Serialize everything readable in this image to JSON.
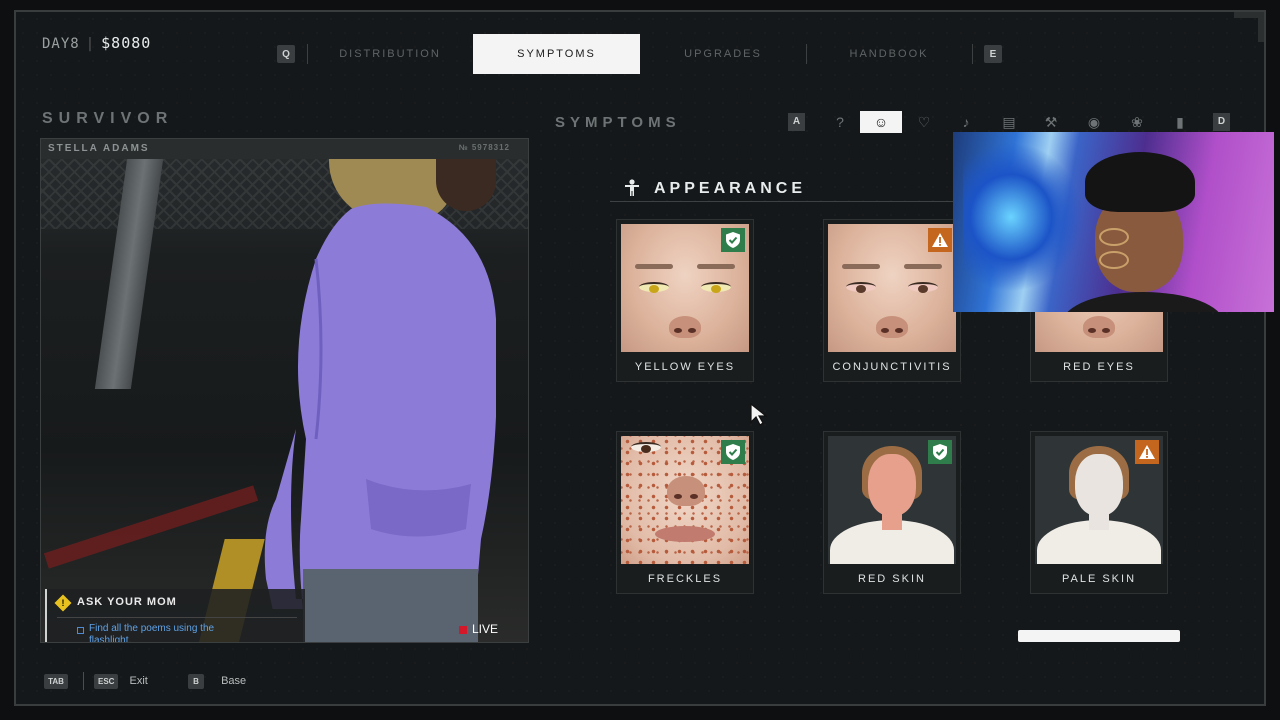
{
  "hud": {
    "day": "DAY8",
    "money": "$8080"
  },
  "nav": {
    "key_left": "Q",
    "key_right": "E",
    "tabs": [
      {
        "label": "DISTRIBUTION",
        "active": false
      },
      {
        "label": "SYMPTOMS",
        "active": true
      },
      {
        "label": "UPGRADES",
        "active": false
      },
      {
        "label": "HANDBOOK",
        "active": false
      }
    ]
  },
  "survivor": {
    "section_title": "SURVIVOR",
    "name": "STELLA ADAMS",
    "id": "№ 5978312",
    "quest": {
      "title": "ASK YOUR MOM",
      "objective": "Find all the poems using the flashlight."
    },
    "live_label": "LIVE"
  },
  "symptoms": {
    "section_title": "SYMPTOMS",
    "key_left": "A",
    "key_right": "D",
    "categories": [
      {
        "icon": "question-icon",
        "glyph": "?"
      },
      {
        "icon": "body-appearance-icon",
        "glyph": "☺",
        "active": true
      },
      {
        "icon": "heart-icon",
        "glyph": "♡"
      },
      {
        "icon": "speaker-icon",
        "glyph": "♪"
      },
      {
        "icon": "stomach-icon",
        "glyph": "▤"
      },
      {
        "icon": "tools-icon",
        "glyph": "⚒"
      },
      {
        "icon": "eye-icon",
        "glyph": "◉"
      },
      {
        "icon": "brain-icon",
        "glyph": "❀"
      },
      {
        "icon": "bottle-icon",
        "glyph": "▮"
      }
    ],
    "group_title": "APPEARANCE",
    "cards": [
      {
        "label": "YELLOW EYES",
        "badge": "ok",
        "variant": "eyes-yellow"
      },
      {
        "label": "CONJUNCTIVITIS",
        "badge": "warn",
        "variant": "eyes-pink"
      },
      {
        "label": "RED EYES",
        "badge": "none",
        "variant": "nose-only"
      },
      {
        "label": "FRECKLES",
        "badge": "ok",
        "variant": "freckles"
      },
      {
        "label": "RED SKIN",
        "badge": "ok",
        "variant": "bust-red"
      },
      {
        "label": "PALE SKIN",
        "badge": "warn",
        "variant": "bust-pale"
      }
    ]
  },
  "footer": {
    "items": [
      {
        "key": "TAB",
        "label": ""
      },
      {
        "key": "ESC",
        "label": "Exit"
      },
      {
        "key": "B",
        "label": "Base"
      }
    ]
  },
  "colors": {
    "ok": "#2e7d4a",
    "warn": "#c4661d",
    "active_tab": "#f4f4f4",
    "quest_text": "#5fa2e6",
    "live": "#d4182a"
  }
}
